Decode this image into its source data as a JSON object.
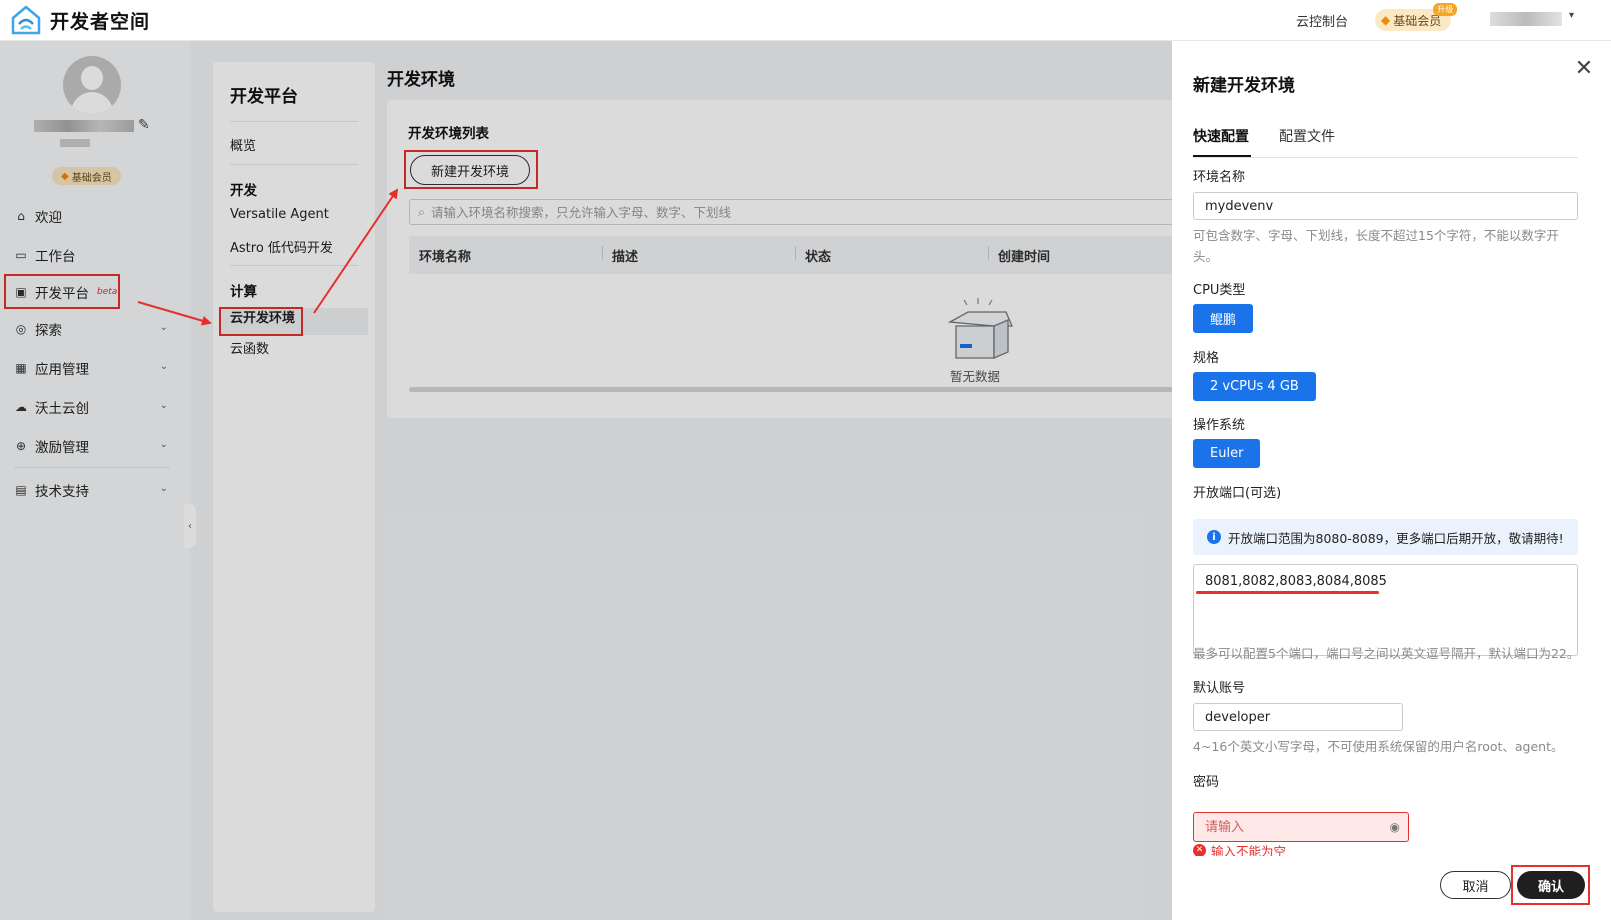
{
  "header": {
    "logo_text": "开发者空间",
    "console_link": "云控制台",
    "member_badge": "基础会员",
    "upgrade_tag": "升级"
  },
  "sidebar": {
    "member_badge": "基础会员",
    "items": [
      {
        "label": "欢迎",
        "icon": "home-icon"
      },
      {
        "label": "工作台",
        "icon": "desktop-icon"
      },
      {
        "label": "开发平台",
        "icon": "monitor-icon",
        "tag": "beta"
      },
      {
        "label": "探索",
        "icon": "compass-icon"
      },
      {
        "label": "应用管理",
        "icon": "app-icon"
      },
      {
        "label": "沃土云创",
        "icon": "cloud-icon"
      },
      {
        "label": "激励管理",
        "icon": "gift-icon"
      },
      {
        "label": "技术支持",
        "icon": "support-icon"
      }
    ]
  },
  "subnav": {
    "title": "开发平台",
    "overview": "概览",
    "group_dev": "开发",
    "versatile": "Versatile Agent",
    "astro": "Astro 低代码开发",
    "group_compute": "计算",
    "cloud_env": "云开发环境",
    "cloud_func": "云函数"
  },
  "main": {
    "title": "开发环境",
    "list_title": "开发环境列表",
    "new_button": "新建开发环境",
    "search_placeholder": "请输入环境名称搜索，只允许输入字母、数字、下划线",
    "columns": [
      "环境名称",
      "描述",
      "状态",
      "创建时间"
    ],
    "empty_text": "暂无数据"
  },
  "drawer": {
    "title": "新建开发环境",
    "tabs": [
      "快速配置",
      "配置文件"
    ],
    "env_name_label": "环境名称",
    "env_name_value": "mydevenv",
    "env_name_hint": "可包含数字、字母、下划线，长度不超过15个字符，不能以数字开头。",
    "cpu_label": "CPU类型",
    "cpu_value": "鲲鹏",
    "spec_label": "规格",
    "spec_value": "2 vCPUs 4 GB",
    "os_label": "操作系统",
    "os_value": "Euler",
    "port_label": "开放端口(可选)",
    "port_info": "开放端口范围为8080-8089，更多端口后期开放，敬请期待!",
    "port_value": "8081,8082,8083,8084,8085",
    "port_hint": "最多可以配置5个端口，端口号之间以英文逗号隔开，默认端口为22。",
    "account_label": "默认账号",
    "account_value": "developer",
    "account_hint": "4~16个英文小写字母，不可使用系统保留的用户名root、agent。",
    "password_label": "密码",
    "password_placeholder": "请输入",
    "password_error": "输入不能为空",
    "cancel": "取消",
    "confirm": "确认"
  },
  "colors": {
    "accent": "#1a73e8",
    "annotation_red": "#e5302c",
    "primary_button": "#1f1f1f"
  }
}
